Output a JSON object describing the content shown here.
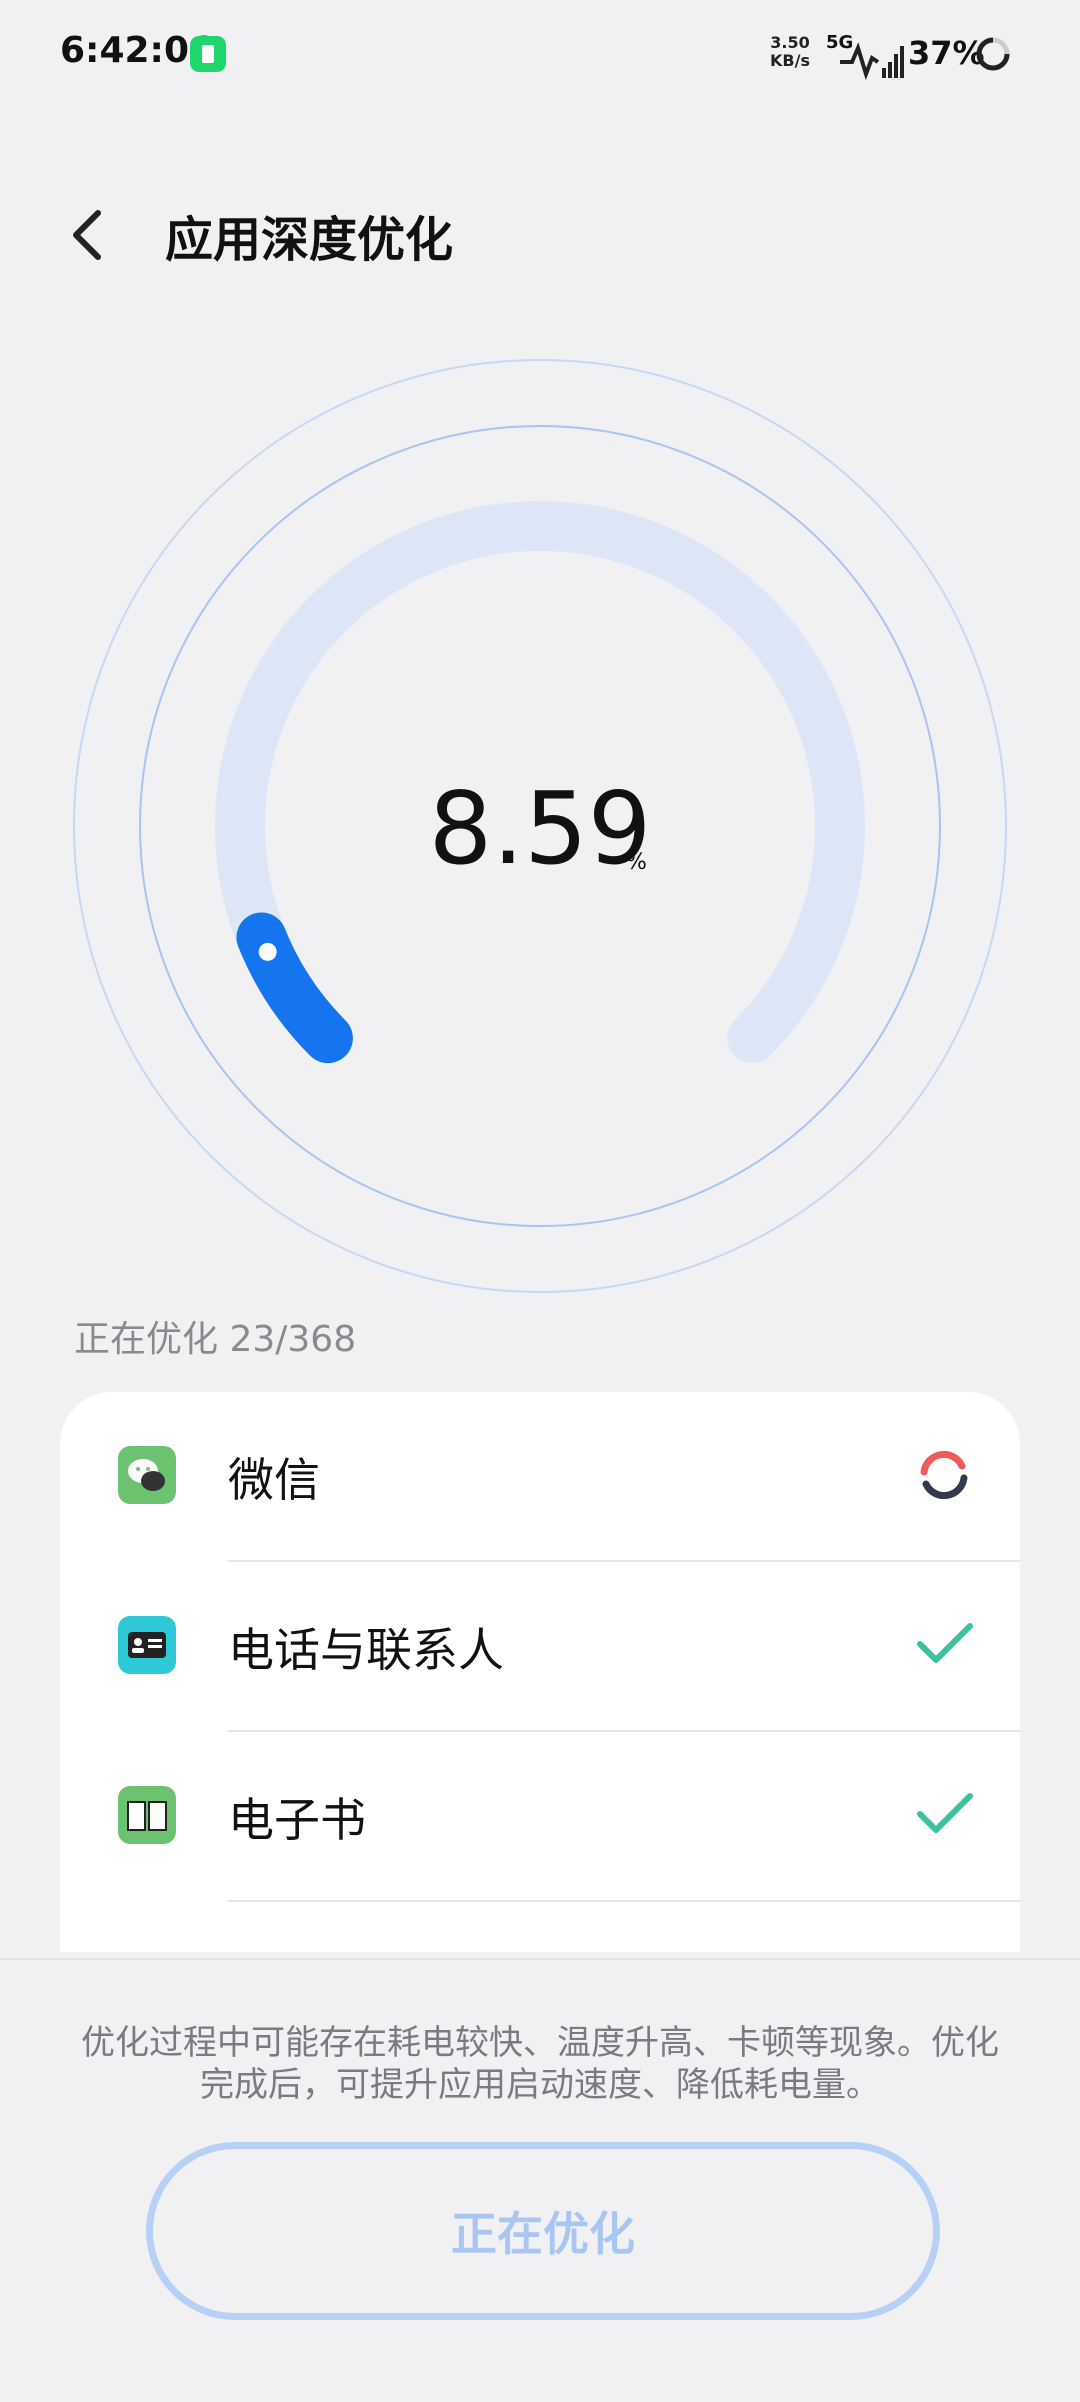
{
  "status_bar": {
    "time": "6:42:06",
    "net_speed": "3.50",
    "net_unit": "KB/s",
    "network": "5G",
    "battery": "37%"
  },
  "header": {
    "title": "应用深度优化"
  },
  "gauge": {
    "value": "8.59",
    "unit": "%",
    "progress_fraction": 0.0859
  },
  "progress": {
    "label": "正在优化",
    "count": "23/368"
  },
  "apps": [
    {
      "name": "微信",
      "status": "in-progress",
      "icon": "wechat-icon"
    },
    {
      "name": "电话与联系人",
      "status": "done",
      "icon": "contacts-icon"
    },
    {
      "name": "电子书",
      "status": "done",
      "icon": "ebook-icon"
    }
  ],
  "notice": "优化过程中可能存在耗电较快、温度升高、卡顿等现象。优化完成后，可提升应用启动速度、降低耗电量。",
  "button": {
    "label": "正在优化"
  },
  "colors": {
    "accent": "#1575ee",
    "track": "#dce6f6",
    "check": "#3cc1a0"
  }
}
